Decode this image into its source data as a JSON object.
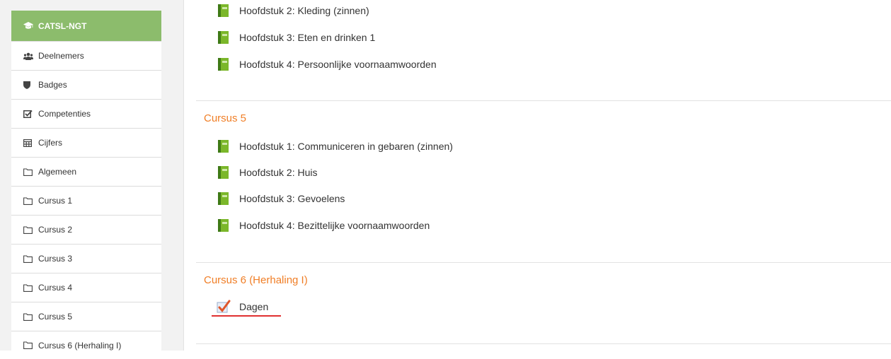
{
  "sidebar": {
    "items": [
      {
        "label": "CATSL-NGT",
        "icon": "graduation-cap-icon",
        "active": true
      },
      {
        "label": "Deelnemers",
        "icon": "users-icon"
      },
      {
        "label": "Badges",
        "icon": "shield-icon"
      },
      {
        "label": "Competenties",
        "icon": "check-square-icon"
      },
      {
        "label": "Cijfers",
        "icon": "table-icon"
      },
      {
        "label": "Algemeen",
        "icon": "folder-icon"
      },
      {
        "label": "Cursus 1",
        "icon": "folder-icon"
      },
      {
        "label": "Cursus 2",
        "icon": "folder-icon"
      },
      {
        "label": "Cursus 3",
        "icon": "folder-icon"
      },
      {
        "label": "Cursus 4",
        "icon": "folder-icon"
      },
      {
        "label": "Cursus 5",
        "icon": "folder-icon"
      },
      {
        "label": "Cursus 6 (Herhaling I)",
        "icon": "folder-icon"
      }
    ]
  },
  "main": {
    "prev_section": {
      "activities": [
        {
          "label": "Hoofdstuk 2: Kleding (zinnen)",
          "icon": "book-icon"
        },
        {
          "label": "Hoofdstuk 3: Eten en drinken 1",
          "icon": "book-icon"
        },
        {
          "label": "Hoofdstuk 4: Persoonlijke voornaamwoorden",
          "icon": "book-icon"
        }
      ]
    },
    "section5": {
      "title": "Cursus 5",
      "activities": [
        {
          "label": "Hoofdstuk 1: Communiceren in gebaren (zinnen)",
          "icon": "book-icon"
        },
        {
          "label": "Hoofdstuk 2: Huis",
          "icon": "book-icon"
        },
        {
          "label": "Hoofdstuk 3: Gevoelens",
          "icon": "book-icon"
        },
        {
          "label": "Hoofdstuk 4: Bezittelijke voornaamwoorden",
          "icon": "book-icon"
        }
      ]
    },
    "section6": {
      "title": "Cursus 6 (Herhaling I)",
      "activities": [
        {
          "label": "Dagen",
          "icon": "quiz-check-icon"
        }
      ]
    }
  },
  "colors": {
    "active_nav": "#8cbc6c",
    "section_title": "#f07e26",
    "highlight_underline": "#e03030"
  }
}
